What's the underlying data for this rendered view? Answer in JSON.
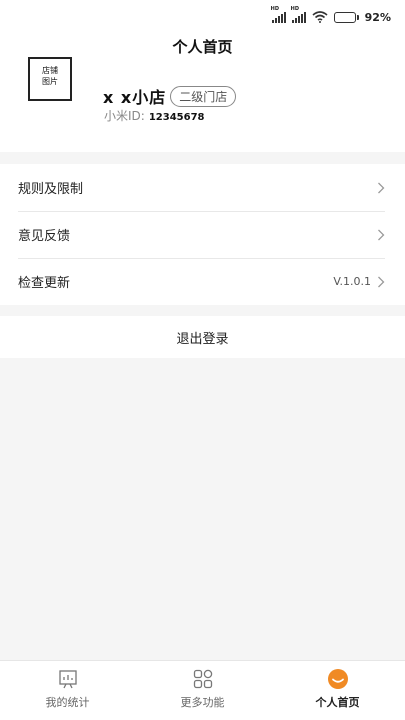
{
  "status_bar": {
    "signal_1_tag": "HD",
    "signal_2_tag": "HD",
    "battery_percent": 92,
    "battery_text": "92%"
  },
  "header": {
    "title": "个人首页",
    "shop_image_label_line1": "店铺",
    "shop_image_label_line2": "图片",
    "shop_name": "x x小店",
    "level_badge": "二级门店",
    "id_label": "小米ID:",
    "id_value": "12345678"
  },
  "menu": {
    "items": [
      {
        "label": "规则及限制",
        "value": ""
      },
      {
        "label": "意见反馈",
        "value": ""
      },
      {
        "label": "检查更新",
        "value": "V.1.0.1"
      }
    ]
  },
  "logout": {
    "label": "退出登录"
  },
  "tabbar": {
    "active_color": "#f08a24",
    "tabs": [
      {
        "label": "我的统计",
        "icon": "chart-board-icon",
        "active": false
      },
      {
        "label": "更多功能",
        "icon": "grid-apps-icon",
        "active": false
      },
      {
        "label": "个人首页",
        "icon": "smile-face-icon",
        "active": true
      }
    ]
  }
}
